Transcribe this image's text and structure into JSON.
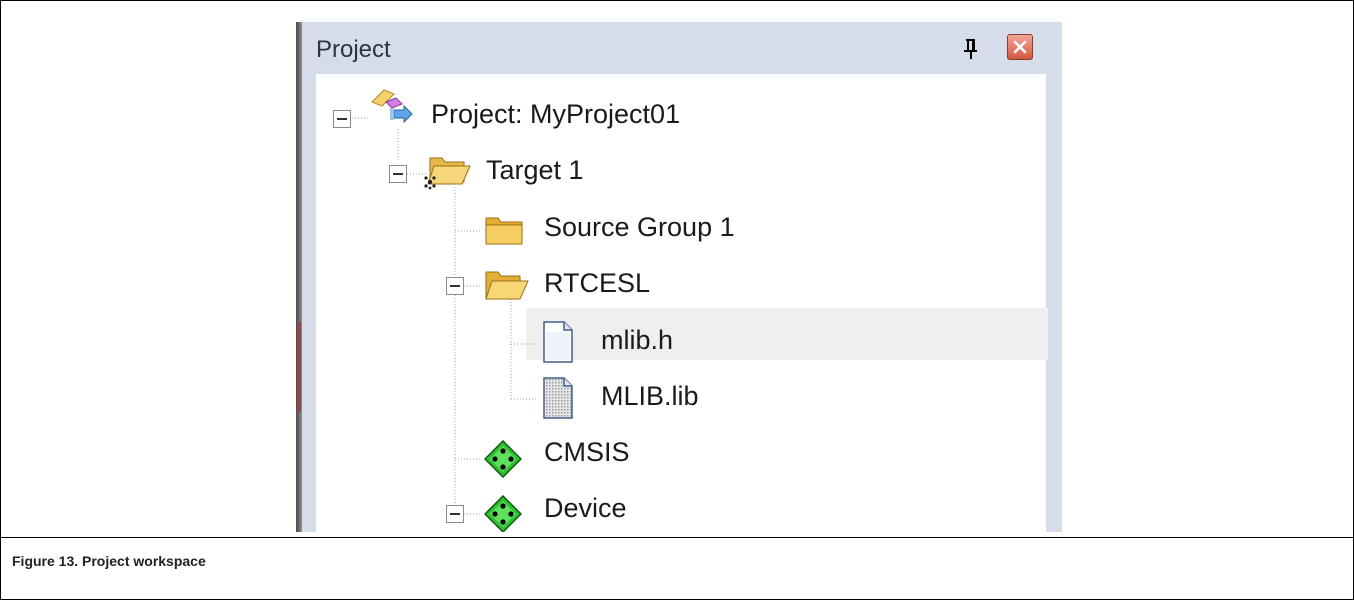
{
  "pane": {
    "title": "Project",
    "pin_icon": "pin-icon",
    "close_icon": "close-icon"
  },
  "tree": {
    "root": {
      "label": "Project: MyProject01",
      "icon": "project-icon",
      "expanded": true
    },
    "target": {
      "label": "Target 1",
      "icon": "target-folder-icon",
      "expanded": true
    },
    "source_group": {
      "label": "Source Group 1",
      "icon": "folder-icon"
    },
    "rtcesl": {
      "label": "RTCESL",
      "icon": "open-folder-icon",
      "expanded": true,
      "selected": true
    },
    "mlib_h": {
      "label": "mlib.h",
      "icon": "file-icon"
    },
    "mlib_lib": {
      "label": "MLIB.lib",
      "icon": "library-file-icon"
    },
    "cmsis": {
      "label": "CMSIS",
      "icon": "component-icon"
    },
    "device": {
      "label": "Device",
      "icon": "component-icon",
      "expanded": true
    }
  },
  "caption": "Figure 13. Project workspace"
}
